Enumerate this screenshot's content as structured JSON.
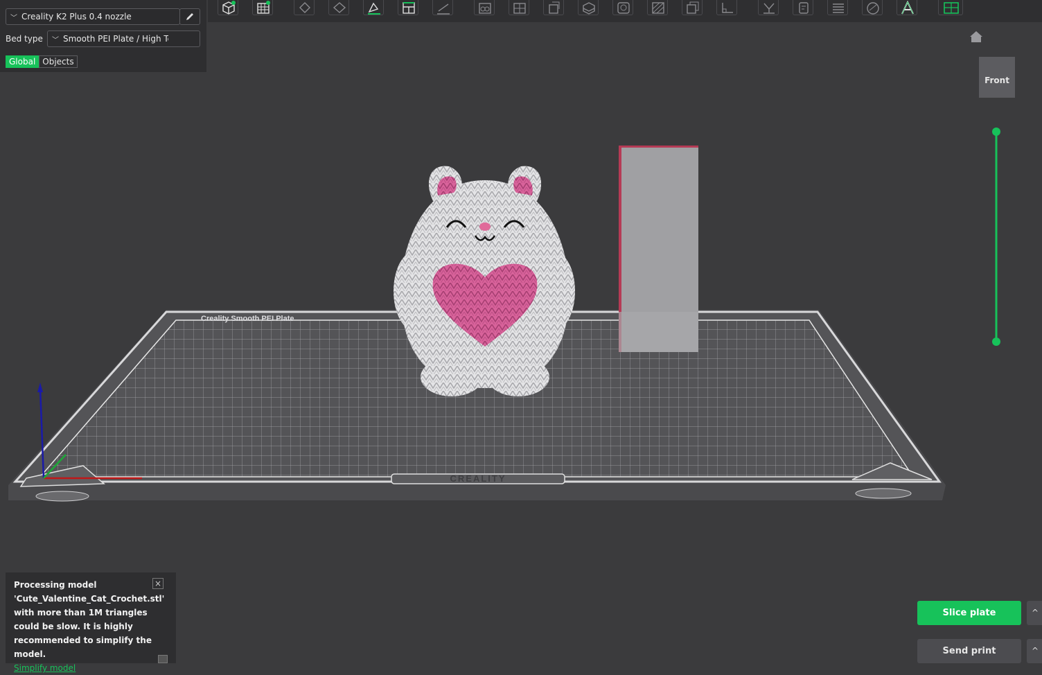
{
  "printer": {
    "name": "Creality K2 Plus 0.4 nozzle"
  },
  "bed": {
    "label": "Bed type",
    "value": "Smooth PEI Plate / High Temp Plate"
  },
  "scope_tabs": [
    {
      "label": "Global",
      "active": true
    },
    {
      "label": "Objects",
      "active": false
    }
  ],
  "toolbar": {
    "icons": [
      "add-object-icon",
      "add-plate-icon",
      "auto-orient-icon",
      "arrange-icon",
      "lay-on-face-icon",
      "split-objects-icon",
      "cut-icon",
      "variable-layer-icon",
      "fuzzy-icon",
      "support-paint-icon",
      "seam-paint-icon",
      "mmu-paint-icon",
      "measure-icon",
      "assembly-icon",
      "scale-icon",
      "layers-icon",
      "text-icon",
      "emboss-icon",
      "view-icon",
      "move-icon",
      "rotate-icon",
      "brim-icon",
      "text-tool-icon",
      "puzzle-icon"
    ]
  },
  "bed_logo": "CREALITY",
  "bed_strip_text": "Creality Smooth PEI Plate",
  "view_cube": {
    "face": "Front"
  },
  "toast": {
    "message": "Processing model 'Cute_Valentine_Cat_Crochet.stl' with more than 1M triangles could be slow. It is highly recommended to simplify the model.",
    "link": "Simplify model"
  },
  "actions": {
    "slice": "Slice plate",
    "send": "Send print",
    "more": "^"
  },
  "colors": {
    "accent": "#17c25a",
    "heart": "#d8629a",
    "background": "#3b3b3d"
  }
}
